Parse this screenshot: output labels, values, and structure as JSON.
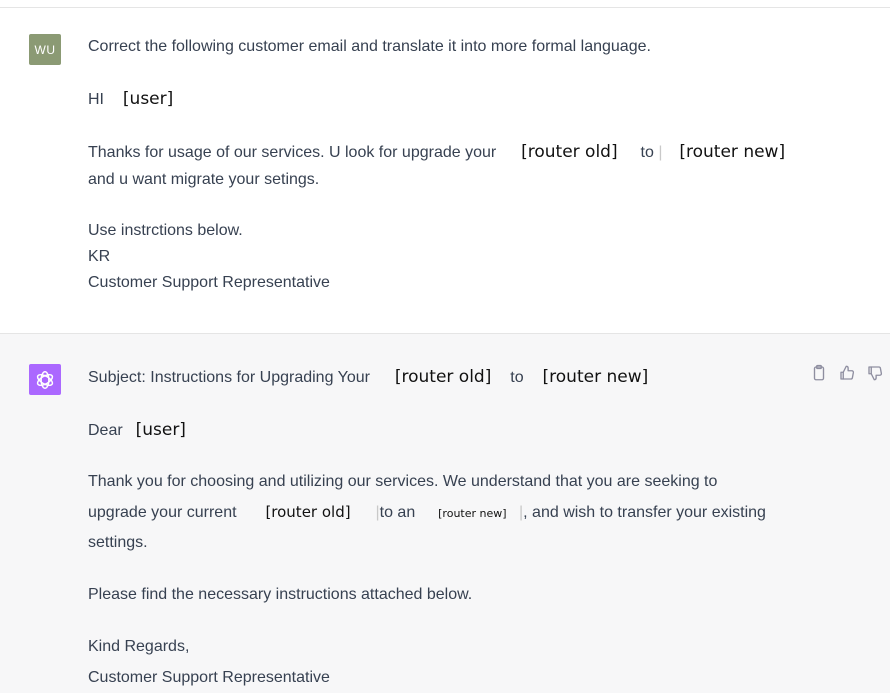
{
  "user_message": {
    "avatar": "WU",
    "prompt": "Correct the following customer email and translate it into more formal language.",
    "greeting": {
      "word": "HI",
      "placeholder": "[user]"
    },
    "body_line1": {
      "text": "Thanks for usage of our services. U look for upgrade your",
      "ph_old": "[router old]",
      "to": "to",
      "ph_new": "[router new]"
    },
    "body_line2": "and u want migrate your  setings.",
    "instr": "Use instrctions below.",
    "sign_kr": "KR",
    "sign_role": "Customer Support Representative"
  },
  "assistant_message": {
    "subject": {
      "text": "Subject: Instructions for Upgrading Your",
      "ph_old": "[router old]",
      "to": "to",
      "ph_new": "[router new]"
    },
    "greeting": {
      "word": "Dear",
      "placeholder": "[user]"
    },
    "para_line1": "Thank you for choosing and utilizing our services. We understand that you are seeking to",
    "para_line2": {
      "text": "upgrade your current",
      "ph_old": "[router old]",
      "to_an": "to an",
      "ph_new": "[router new]",
      "tail": ", and wish to transfer your existing"
    },
    "para_line3": "settings.",
    "instructions": "Please find the necessary instructions attached below.",
    "closing": "Kind Regards,",
    "signature": "Customer Support Representative",
    "actions": [
      "clipboard-icon",
      "thumbs-up-icon",
      "thumbs-down-icon"
    ]
  },
  "colors": {
    "user_avatar": "#8b9a74",
    "bot_avatar": "#ab68ff",
    "assistant_bg": "#f7f7f8"
  }
}
